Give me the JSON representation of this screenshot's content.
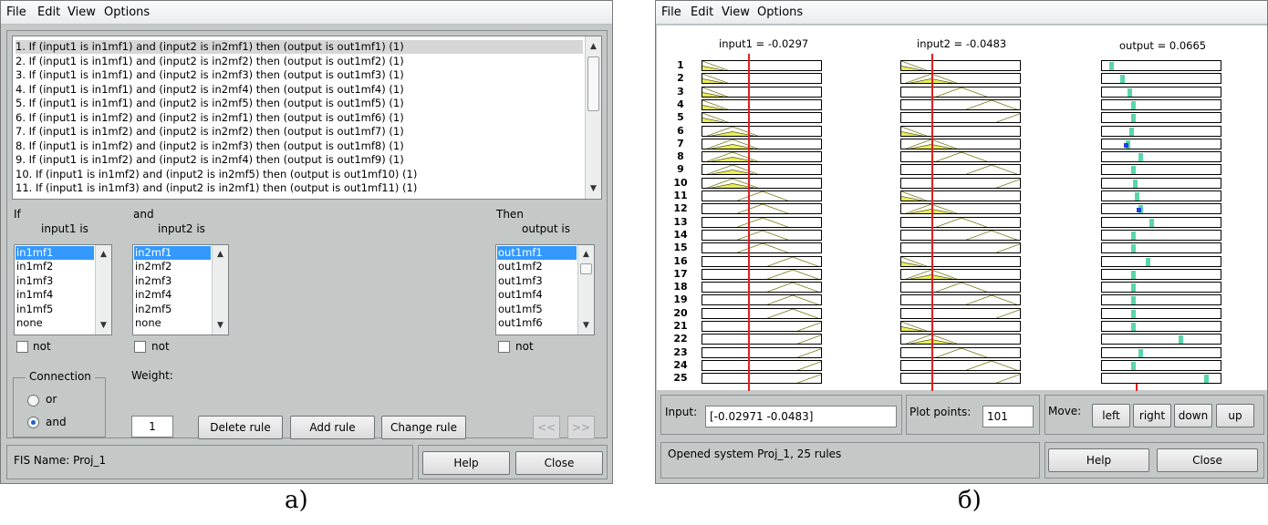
{
  "left": {
    "menu": [
      "File",
      "Edit",
      "View",
      "Options"
    ],
    "rules": [
      "1. If (input1 is in1mf1) and (input2 is in2mf1) then (output is out1mf1) (1)",
      "2. If (input1 is in1mf1) and (input2 is in2mf2) then (output is out1mf2) (1)",
      "3. If (input1 is in1mf1) and (input2 is in2mf3) then (output is out1mf3) (1)",
      "4. If (input1 is in1mf1) and (input2 is in2mf4) then (output is out1mf4) (1)",
      "5. If (input1 is in1mf1) and (input2 is in2mf5) then (output is out1mf5) (1)",
      "6. If (input1 is in1mf2) and (input2 is in2mf1) then (output is out1mf6) (1)",
      "7. If (input1 is in1mf2) and (input2 is in2mf2) then (output is out1mf7) (1)",
      "8. If (input1 is in1mf2) and (input2 is in2mf3) then (output is out1mf8) (1)",
      "9. If (input1 is in1mf2) and (input2 is in2mf4) then (output is out1mf9) (1)",
      "10. If (input1 is in1mf2) and (input2 is in2mf5) then (output is out1mf10) (1)",
      "11. If (input1 is in1mf3) and (input2 is in2mf1) then (output is out1mf11) (1)"
    ],
    "if_label": "If",
    "input1_label": "input1 is",
    "and_label": "and",
    "input2_label": "input2 is",
    "then_label": "Then",
    "output_label": "output is",
    "input1_options": [
      "in1mf1",
      "in1mf2",
      "in1mf3",
      "in1mf4",
      "in1mf5",
      "none"
    ],
    "input2_options": [
      "in2mf1",
      "in2mf2",
      "in2mf3",
      "in2mf4",
      "in2mf5",
      "none"
    ],
    "output_options": [
      "out1mf1",
      "out1mf2",
      "out1mf3",
      "out1mf4",
      "out1mf5",
      "out1mf6"
    ],
    "not_label": "not",
    "connection_label": "Connection",
    "or_label": "or",
    "and_option_label": "and",
    "weight_label": "Weight:",
    "weight_value": "1",
    "delete_rule": "Delete rule",
    "add_rule": "Add rule",
    "change_rule": "Change rule",
    "prev": "<<",
    "next": ">>",
    "fis_name": "FIS Name: Proj_1",
    "help": "Help",
    "close": "Close",
    "caption": "а)"
  },
  "right": {
    "menu": [
      "File",
      "Edit",
      "View",
      "Options"
    ],
    "input1_head": "input1 = -0.0297",
    "input2_head": "input2 = -0.0483",
    "output_head": "output = 0.0665",
    "row_numbers": [
      "1",
      "2",
      "3",
      "4",
      "5",
      "6",
      "7",
      "8",
      "9",
      "10",
      "11",
      "12",
      "13",
      "14",
      "15",
      "16",
      "17",
      "18",
      "19",
      "20",
      "21",
      "22",
      "23",
      "24",
      "25"
    ],
    "input_label": "Input:",
    "input_value": "[-0.02971 -0.0483]",
    "plot_points_label": "Plot points:",
    "plot_points_value": "101",
    "move_label": "Move:",
    "left": "left",
    "right": "right",
    "down": "down",
    "up": "up",
    "status": "Opened system Proj_1, 25 rules",
    "help": "Help",
    "close": "Close",
    "caption": "б)",
    "colors": {
      "fill": "#e8ec5a",
      "output_bar": "#5ad6a8",
      "output_mark": "#2040e0",
      "indicator": "#e02020"
    }
  }
}
